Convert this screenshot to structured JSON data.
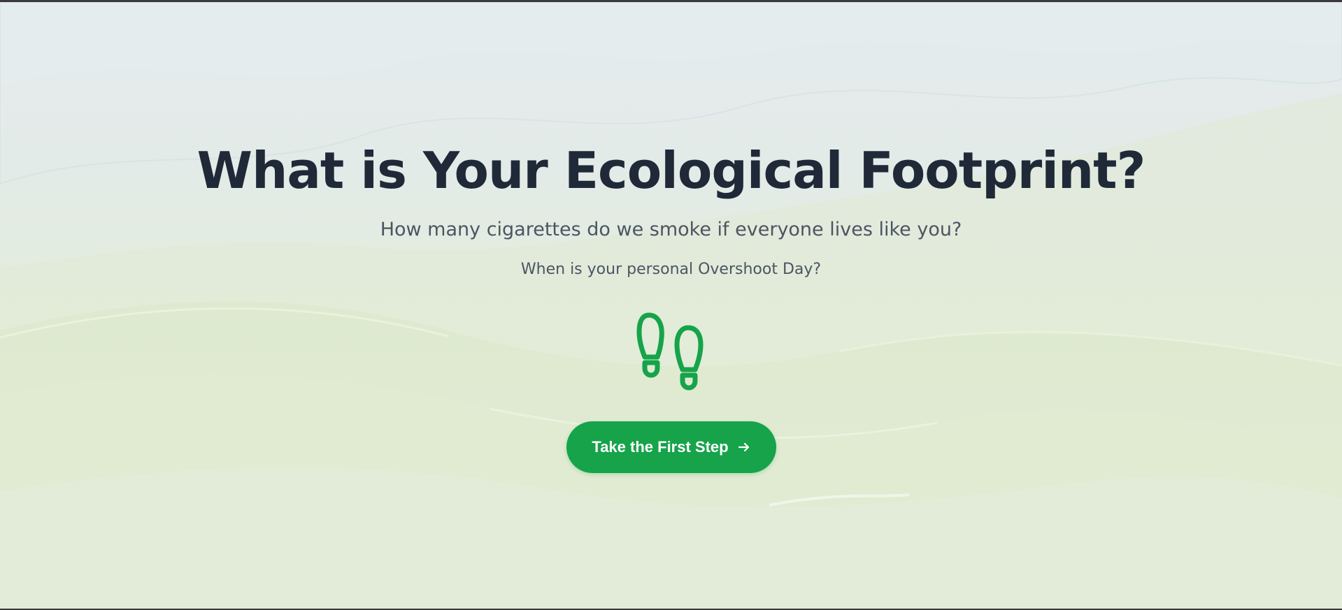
{
  "hero": {
    "title": "What is Your Ecological Footprint?",
    "subtitle": "How many cigarettes do we smoke if everyone lives like you?",
    "question": "When is your personal Overshoot Day?",
    "icon": "footprints-icon",
    "cta_label": "Take the First Step",
    "cta_icon": "arrow-right-icon"
  },
  "colors": {
    "accent": "#16a34a",
    "heading": "#1f2937",
    "body_text": "#4b5563",
    "background_tint": "#e3ebe7"
  }
}
